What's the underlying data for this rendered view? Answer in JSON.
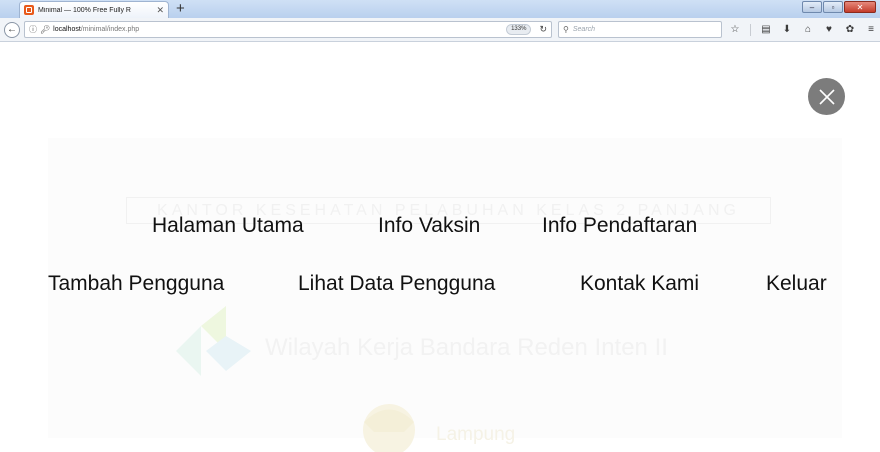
{
  "browser": {
    "tab_title": "Minimal — 100% Free Fully R",
    "url_host": "localhost",
    "url_path": "/minimal/index.php",
    "zoom": "133%",
    "search_placeholder": "Search"
  },
  "background": {
    "banner": "KANTOR KESEHATAN PELABUHAN KELAS 2 PANJANG",
    "wilayah": "Wilayah Kerja Bandara Reden Inten II",
    "lampung": "Lampung"
  },
  "menu": {
    "halaman_utama": "Halaman Utama",
    "info_vaksin": "Info Vaksin",
    "info_pendaftaran": "Info Pendaftaran",
    "tambah_pengguna": "Tambah Pengguna",
    "lihat_data_pengguna": "Lihat Data Pengguna",
    "kontak_kami": "Kontak Kami",
    "keluar": "Keluar"
  },
  "colors": {
    "overlay_close": "#7c7c7c",
    "menu_text": "#111111",
    "tab_favicon": "#e8591a"
  },
  "icons": [
    "close-icon",
    "back-arrow-icon",
    "info-icon",
    "lock-icon",
    "reload-icon",
    "search-icon",
    "bookmark-star-icon",
    "reading-list-icon",
    "download-icon",
    "home-icon",
    "pocket-icon",
    "extension-icon",
    "hamburger-menu-icon"
  ]
}
